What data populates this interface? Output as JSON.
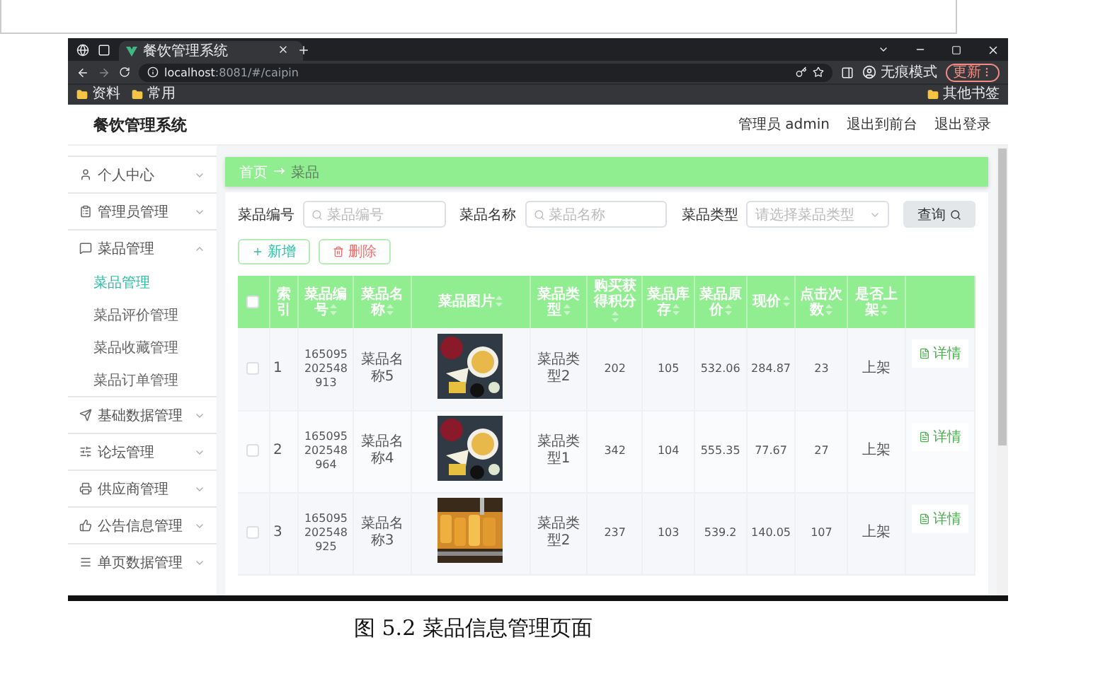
{
  "browser": {
    "tab_title": "餐饮管理系统",
    "url_host": "localhost",
    "url_rest": ":8081/#/caipin",
    "profile": "无痕模式",
    "update_button": "更新",
    "bookmarks": [
      "资料",
      "常用"
    ],
    "other_bookmarks": "其他书签"
  },
  "header": {
    "title": "餐饮管理系统",
    "user": "管理员 admin",
    "links": [
      "退出到前台",
      "退出登录"
    ]
  },
  "sidebar": {
    "items": [
      {
        "label": "个人中心",
        "expanded": false
      },
      {
        "label": "管理员管理",
        "expanded": false
      },
      {
        "label": "菜品管理",
        "expanded": true,
        "children": [
          {
            "label": "菜品管理",
            "selected": true
          },
          {
            "label": "菜品评价管理",
            "selected": false
          },
          {
            "label": "菜品收藏管理",
            "selected": false
          },
          {
            "label": "菜品订单管理",
            "selected": false
          }
        ]
      },
      {
        "label": "基础数据管理",
        "expanded": false
      },
      {
        "label": "论坛管理",
        "expanded": false
      },
      {
        "label": "供应商管理",
        "expanded": false
      },
      {
        "label": "公告信息管理",
        "expanded": false
      },
      {
        "label": "单页数据管理",
        "expanded": false
      }
    ]
  },
  "breadcrumb": {
    "home": "首页",
    "arrow": "→",
    "current": "菜品"
  },
  "search": {
    "fields": [
      {
        "kind": "input",
        "label": "菜品编号",
        "placeholder": "菜品编号"
      },
      {
        "kind": "input",
        "label": "菜品名称",
        "placeholder": "菜品名称"
      },
      {
        "kind": "select",
        "label": "菜品类型",
        "placeholder": "请选择菜品类型"
      }
    ],
    "button": "查询"
  },
  "actions": [
    {
      "kind": "add",
      "label": "新增"
    },
    {
      "kind": "delete",
      "label": "删除"
    }
  ],
  "table": {
    "select_all_checked": false,
    "columns": [
      {
        "label": "索引",
        "sortable": false
      },
      {
        "label": "菜品编号",
        "sortable": true
      },
      {
        "label": "菜品名称",
        "sortable": true
      },
      {
        "label": "菜品图片",
        "sortable": true
      },
      {
        "label": "菜品类型",
        "sortable": true
      },
      {
        "label": "购买获得积分",
        "sortable": true
      },
      {
        "label": "菜品库存",
        "sortable": true
      },
      {
        "label": "菜品原价",
        "sortable": true
      },
      {
        "label": "现价",
        "sortable": true
      },
      {
        "label": "点击次数",
        "sortable": true
      },
      {
        "label": "是否上架",
        "sortable": true
      }
    ],
    "rows": [
      {
        "checked": false,
        "cells": [
          "1",
          "165095202548913",
          "菜品名称5",
          null,
          "菜品类型2",
          "202",
          "105",
          "532.06",
          "284.87",
          "23",
          "上架"
        ],
        "action": "详情"
      },
      {
        "checked": false,
        "cells": [
          "2",
          "165095202548964",
          "菜品名称4",
          null,
          "菜品类型1",
          "342",
          "104",
          "555.35",
          "77.67",
          "27",
          "上架"
        ],
        "action": "详情"
      },
      {
        "checked": false,
        "cells": [
          "3",
          "165095202548925",
          "菜品名称3",
          null,
          "菜品类型2",
          "237",
          "103",
          "539.2",
          "140.05",
          "107",
          "上架"
        ],
        "action": "详情"
      }
    ]
  },
  "caption": "图 5.2 菜品信息管理页面"
}
